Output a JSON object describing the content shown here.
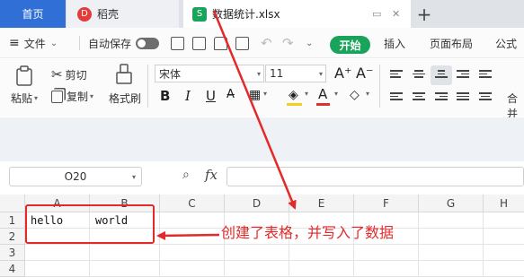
{
  "tabs": {
    "home": "首页",
    "docer": "稻壳",
    "docer_icon": "D",
    "file": "数据统计.xlsx",
    "file_icon": "S",
    "add": "+"
  },
  "menu": {
    "file": "文件",
    "autosave": "自动保存",
    "start": "开始",
    "insert": "插入",
    "page_layout": "页面布局",
    "formula": "公式"
  },
  "ribbon": {
    "cut": "剪切",
    "paste": "粘贴",
    "copy": "复制",
    "format_painter": "格式刷",
    "font_name": "宋体",
    "font_size": "11",
    "bold": "B",
    "italic": "I",
    "underline": "U",
    "merge_partial": "合并"
  },
  "formula_bar": {
    "name_box": "O20",
    "fx": "fx",
    "zoom_icon": "magnifier-icon"
  },
  "sheet": {
    "columns": [
      "A",
      "B",
      "C",
      "D",
      "E",
      "F",
      "G",
      "H"
    ],
    "rows": [
      "1",
      "2",
      "3",
      "4"
    ],
    "cells": {
      "A1": "hello",
      "B1": "world"
    }
  },
  "annotation": {
    "text": "创建了表格，并写入了数据",
    "color": "#e22a2a"
  },
  "colors": {
    "accent_green": "#1aa35a",
    "home_tab_blue": "#2f6fd6",
    "annotation_red": "#e22a2a"
  }
}
